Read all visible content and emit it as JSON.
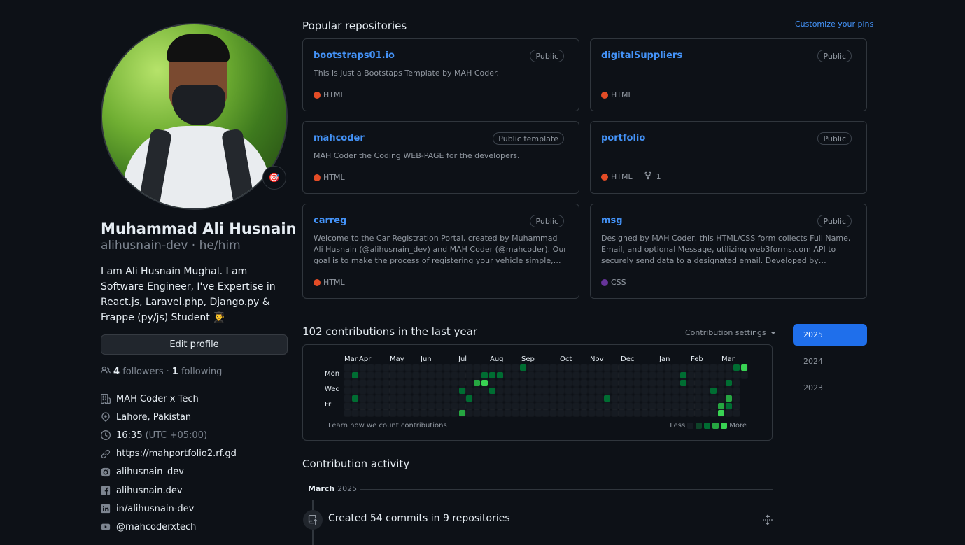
{
  "profile": {
    "name": "Muhammad Ali Husnain",
    "login_line": "alihusnain-dev · he/him",
    "bio": "I am Ali Husnain Mughal. I am Software Engineer, I've Expertise in React.js, Laravel.php, Django.py & Frappe (py/js) Student 👨‍🎓",
    "status_emoji": "🎯",
    "edit_label": "Edit profile",
    "followers_count": "4",
    "followers_label": "followers",
    "separator": "·",
    "following_count": "1",
    "following_label": "following",
    "company": "MAH Coder x Tech",
    "location": "Lahore, Pakistan",
    "time": "16:35",
    "timezone": "(UTC +05:00)",
    "website": "https://mahportfolio2.rf.gd",
    "instagram": "alihusnain_dev",
    "facebook": "alihusnain.dev",
    "linkedin": "in/alihusnain-dev",
    "youtube": "@mahcoderxtech"
  },
  "pinned": {
    "title": "Popular repositories",
    "customize_label": "Customize your pins",
    "repos": [
      {
        "name": "bootstraps01.io",
        "badge": "Public",
        "description": "This is just a Bootstaps Template by MAH Coder.",
        "language": "HTML",
        "lang_color": "#e34c26"
      },
      {
        "name": "digitalSuppliers",
        "badge": "Public",
        "description": "",
        "language": "HTML",
        "lang_color": "#e34c26"
      },
      {
        "name": "mahcoder",
        "badge": "Public template",
        "description": "MAH Coder the Coding WEB-PAGE for the developers.",
        "language": "HTML",
        "lang_color": "#e34c26"
      },
      {
        "name": "portfolio",
        "badge": "Public",
        "description": "",
        "language": "HTML",
        "lang_color": "#e34c26",
        "forks": "1"
      },
      {
        "name": "carreg",
        "badge": "Public",
        "description": "Welcome to the Car Registration Portal, created by Muhammad Ali Husnain (@alihusnain_dev) and MAH Coder (@mahcoder). Our goal is to make the process of registering your vehicle simple, convenient, ...",
        "language": "HTML",
        "lang_color": "#e34c26"
      },
      {
        "name": "msg",
        "badge": "Public",
        "description": "Designed by MAH Coder, this HTML/CSS form collects Full Name, Email, and optional Message, utilizing web3forms.com API to securely send data to a designated email. Developed by Muhammad Ali Husnain...",
        "language": "CSS",
        "lang_color": "#663399"
      }
    ]
  },
  "contributions": {
    "title": "102 contributions in the last year",
    "settings_label": "Contribution settings",
    "months": [
      "Mar",
      "Apr",
      "May",
      "Jun",
      "Jul",
      "Aug",
      "Sep",
      "Oct",
      "Nov",
      "Dec",
      "Jan",
      "Feb",
      "Mar"
    ],
    "days": [
      "Mon",
      "Wed",
      "Fri"
    ],
    "footer_link": "Learn how we count contributions",
    "legend_less": "Less",
    "legend_more": "More",
    "level_colors": [
      "#161b22",
      "#0e4429",
      "#006d32",
      "#26a641",
      "#39d353"
    ],
    "active_cells": [
      {
        "week": 1,
        "day": 1,
        "level": 2
      },
      {
        "week": 1,
        "day": 4,
        "level": 2
      },
      {
        "week": 17,
        "day": 2,
        "level": 3
      },
      {
        "week": 18,
        "day": 1,
        "level": 2
      },
      {
        "week": 18,
        "day": 2,
        "level": 4
      },
      {
        "week": 19,
        "day": 1,
        "level": 2
      },
      {
        "week": 20,
        "day": 1,
        "level": 2
      },
      {
        "week": 19,
        "day": 3,
        "level": 2
      },
      {
        "week": 15,
        "day": 3,
        "level": 2
      },
      {
        "week": 16,
        "day": 4,
        "level": 2
      },
      {
        "week": 15,
        "day": 6,
        "level": 3
      },
      {
        "week": 23,
        "day": 0,
        "level": 2
      },
      {
        "week": 34,
        "day": 4,
        "level": 2
      },
      {
        "week": 44,
        "day": 1,
        "level": 2
      },
      {
        "week": 44,
        "day": 2,
        "level": 2
      },
      {
        "week": 48,
        "day": 3,
        "level": 2
      },
      {
        "week": 49,
        "day": 5,
        "level": 3
      },
      {
        "week": 49,
        "day": 6,
        "level": 4
      },
      {
        "week": 50,
        "day": 2,
        "level": 2
      },
      {
        "week": 50,
        "day": 4,
        "level": 3
      },
      {
        "week": 50,
        "day": 5,
        "level": 2
      },
      {
        "week": 51,
        "day": 0,
        "level": 2
      },
      {
        "week": 52,
        "day": 0,
        "level": 4
      }
    ]
  },
  "years": [
    "2025",
    "2024",
    "2023"
  ],
  "activity": {
    "title": "Contribution activity",
    "month": "March",
    "year": "2025",
    "item": "Created 54 commits in 9 repositories"
  }
}
